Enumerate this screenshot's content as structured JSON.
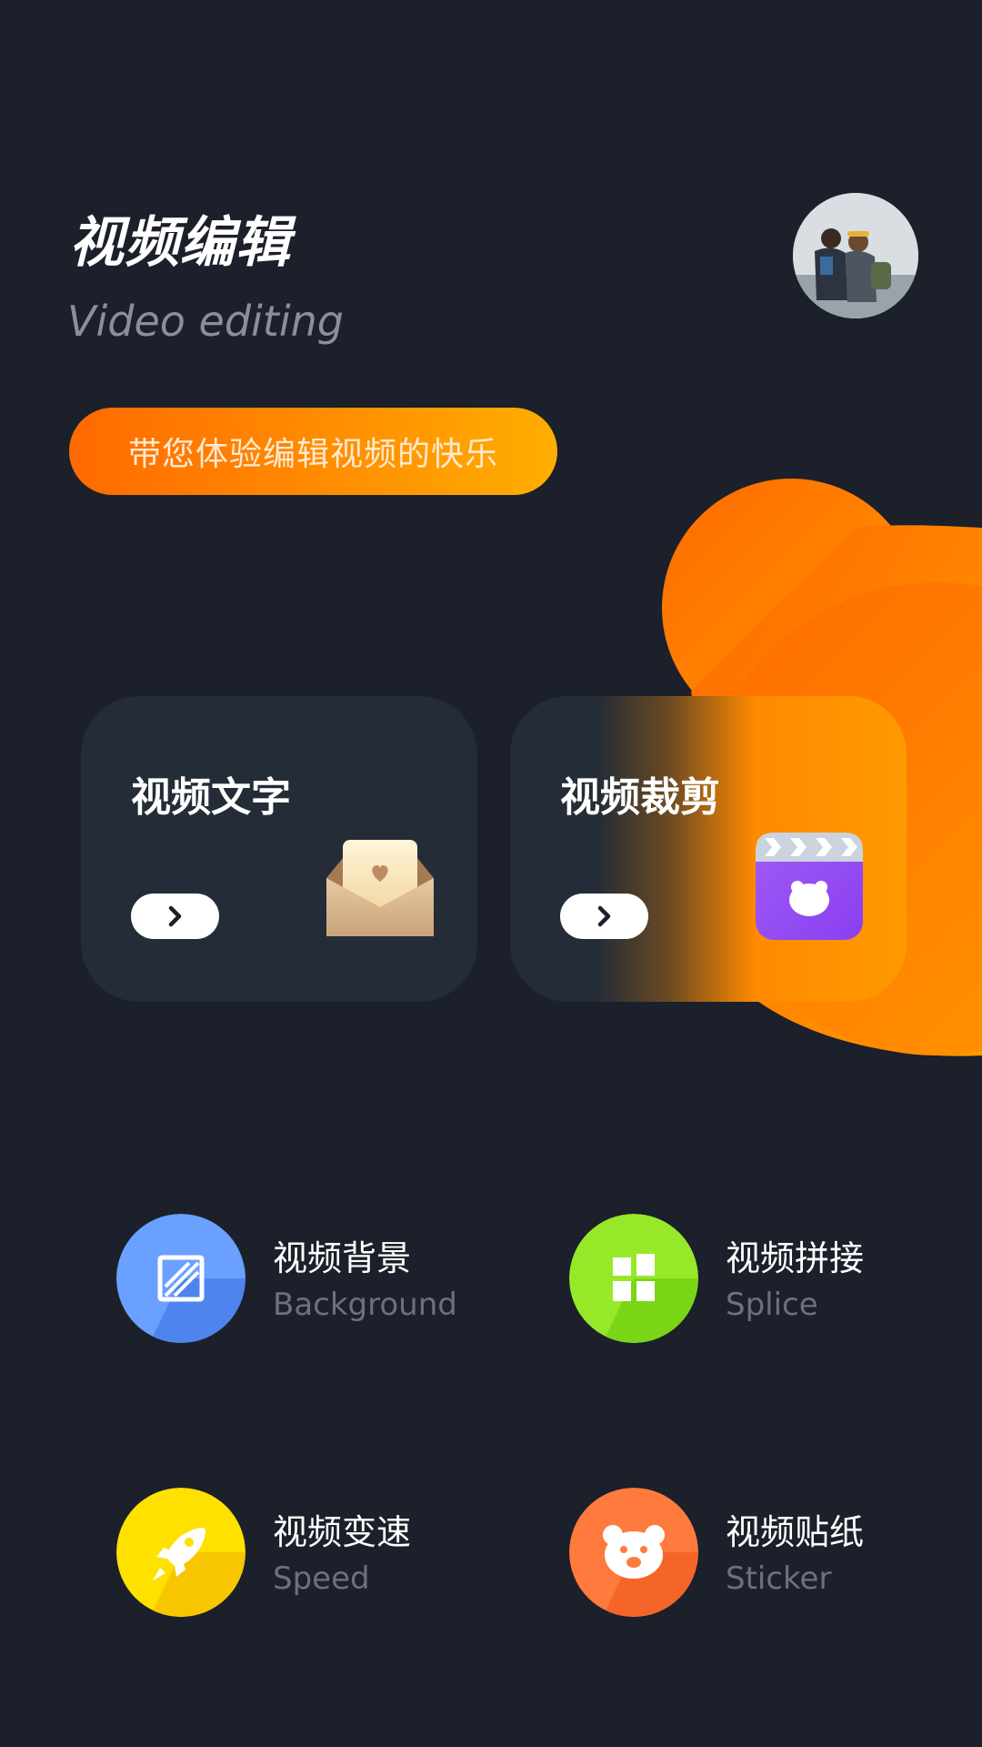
{
  "header": {
    "title": "视频编辑",
    "subtitle": "Video editing",
    "tagline": "带您体验编辑视频的快乐"
  },
  "cards": [
    {
      "title": "视频文字",
      "icon": "envelope-heart-icon"
    },
    {
      "title": "视频裁剪",
      "icon": "clapperboard-bear-icon"
    }
  ],
  "tools": [
    {
      "name": "视频背景",
      "sub": "Background",
      "icon": "background-icon",
      "color": "#5b8ff9"
    },
    {
      "name": "视频拼接",
      "sub": "Splice",
      "icon": "grid-icon",
      "color": "#8ee022"
    },
    {
      "name": "视频变速",
      "sub": "Speed",
      "icon": "rocket-icon",
      "color": "#ffd400"
    },
    {
      "name": "视频贴纸",
      "sub": "Sticker",
      "icon": "bear-icon",
      "color": "#ff7438"
    }
  ],
  "colors": {
    "background": "#1b202a",
    "accent": "#ff7a00",
    "card": "#242c37"
  }
}
